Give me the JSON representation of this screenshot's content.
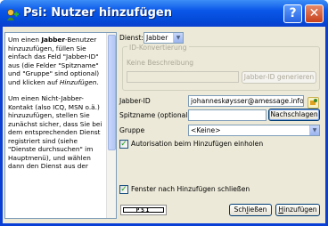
{
  "window": {
    "title": "Psi: Nutzer hinzufügen"
  },
  "help": {
    "p1": [
      "Um einen ",
      "Jabber",
      "-Benutzer hinzuzufügen, füllen Sie einfach das Feld \"Jabber-ID\" aus (die Felder \"Spitzname\" und \"Gruppe\" sind optional) und klicken auf ",
      "Hinzufügen",
      "."
    ],
    "p2": "Um einen Nicht-Jabber-Kontakt (also ICQ, MSN o.ä.) hinzuzufügen, stellen Sie zunächst sicher, dass Sie bei dem entsprechenden Dienst registriert sind (siehe \"Dienste durchsuchen\" im Hauptmenü), und wählen dann den Dienst aus der"
  },
  "form": {
    "service_label": "Dienst:",
    "service_value": "Jabber",
    "group_title": "ID-Konvertierung",
    "group_desc": "Keine Beschreibung",
    "convert_input": "",
    "convert_button": "Jabber-ID generieren",
    "jid_label": "Jabber-ID",
    "jid_value": "johanneskøysser@amessage.info",
    "nick_label": "Spitzname (optional)",
    "nick_value": "",
    "lookup_button": "Nachschlagen",
    "group_label": "Gruppe",
    "group_value": "<Keine>",
    "auth_checkbox": "Autorisation beim Hinzufügen einholen",
    "close_checkbox": "Fenster nach Hinzufügen schließen"
  },
  "footer": {
    "logo": "PSI",
    "close_button": [
      "Sch",
      "l",
      "ießen"
    ],
    "add_button": [
      "",
      "H",
      "inzufügen"
    ]
  },
  "colors": {
    "titlebar": "#0a57e8",
    "client": "#ece9d8",
    "border": "#7f9db9",
    "close": "#c8401c"
  }
}
